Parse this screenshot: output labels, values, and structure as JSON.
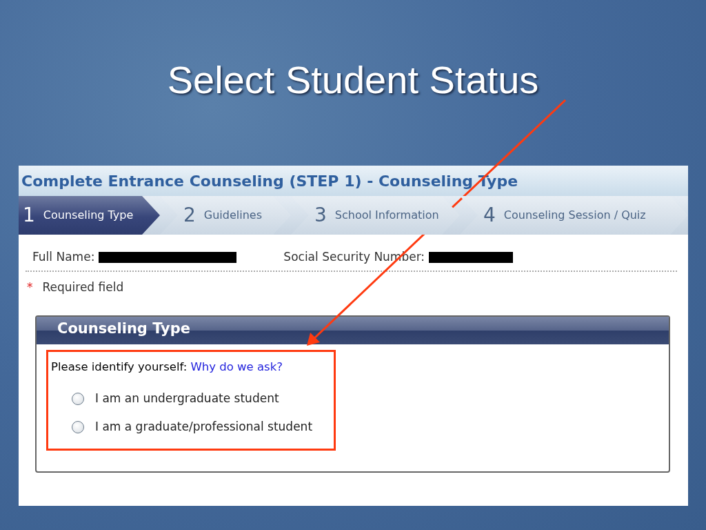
{
  "slide": {
    "title": "Select Student Status"
  },
  "app": {
    "title": "Complete Entrance Counseling (STEP 1) - Counseling Type"
  },
  "steps": [
    {
      "number": "1",
      "label": "Counseling Type",
      "selected": true
    },
    {
      "number": "2",
      "label": "Guidelines",
      "selected": false
    },
    {
      "number": "3",
      "label": "School Information",
      "selected": false
    },
    {
      "number": "4",
      "label": "Counseling Session / Quiz",
      "selected": false
    }
  ],
  "fields": [
    {
      "label": "Full Name:",
      "redacted": true
    },
    {
      "label": "Social Security Number:",
      "redacted": true
    }
  ],
  "required": {
    "mark": "*",
    "text": "Required field"
  },
  "section": {
    "title": "Counseling Type",
    "prompt": "Please identify yourself:",
    "link": "Why do we ask?",
    "options": [
      {
        "label": "I am an undergraduate student",
        "selected": false
      },
      {
        "label": "I am a graduate/professional student",
        "selected": false
      }
    ]
  }
}
